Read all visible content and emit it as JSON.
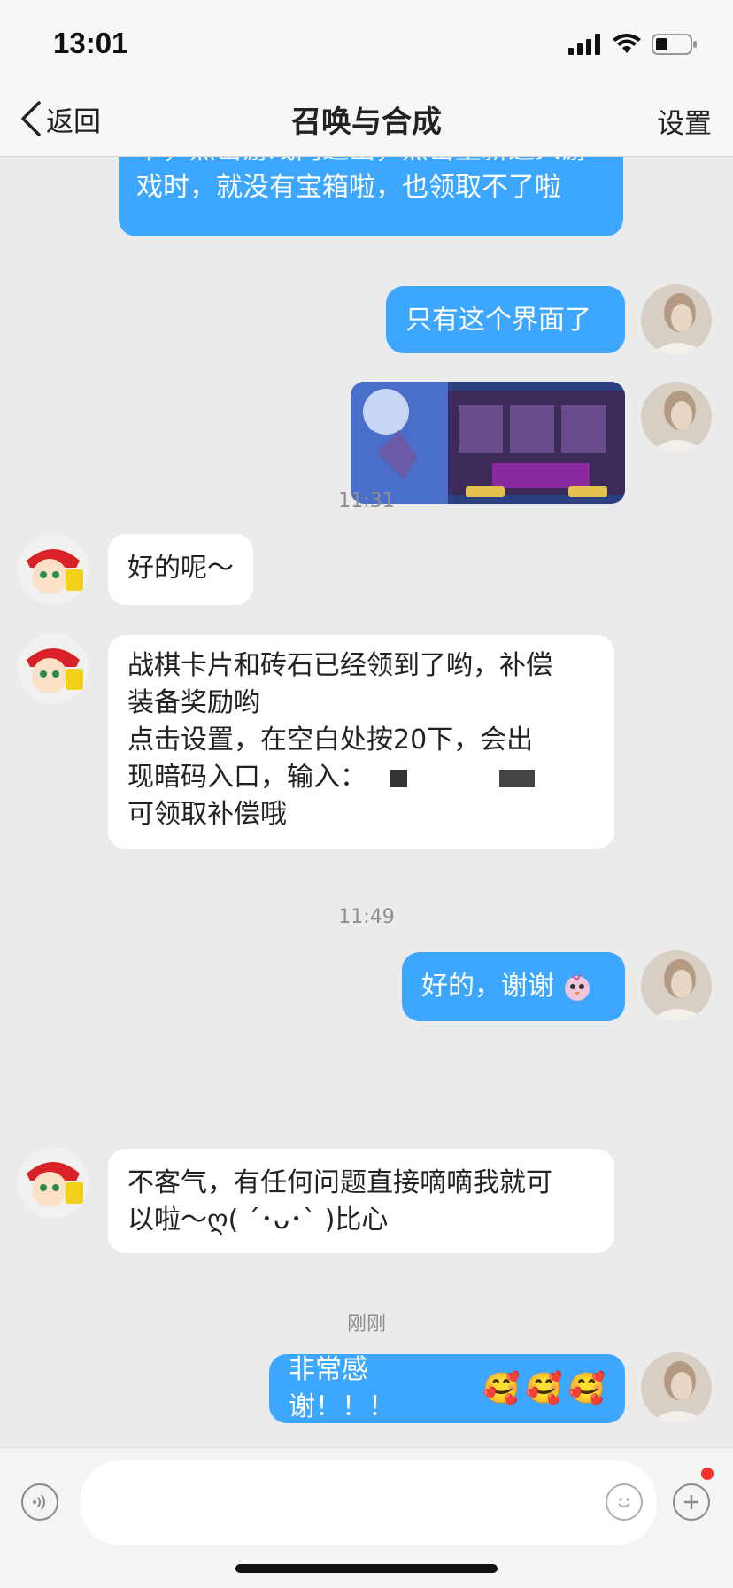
{
  "status_bar": {
    "time": "13:01",
    "battery_level": 0.35
  },
  "nav": {
    "back_label": "返回",
    "title": "召唤与合成",
    "settings_label": "设置"
  },
  "messages": [
    {
      "from": "me",
      "text": "卡，点击游戏内退出，点击重新进入游戏时，就没有宝箱啦，也领取不了啦"
    },
    {
      "from": "me",
      "text": "只有这个界面了"
    },
    {
      "from": "me",
      "type": "image",
      "image_description": "game screenshot"
    },
    {
      "type": "time",
      "text": "11:31"
    },
    {
      "from": "them",
      "text": "好的呢～"
    },
    {
      "from": "them",
      "lines": [
        "战棋卡片和砖石已经领到了哟，补偿",
        "装备奖励哟",
        "点击设置，在空白处按20下，会出",
        "现暗码入口，输入：",
        "可领取补偿哦"
      ]
    },
    {
      "type": "time",
      "text": "11:49"
    },
    {
      "from": "me",
      "text": "好的，谢谢"
    },
    {
      "from": "them",
      "lines": [
        "不客气，有任何问题直接嘀嘀我就可",
        "以啦～ღ( ´･ᴗ･` )比心"
      ]
    },
    {
      "type": "time",
      "text": "刚刚"
    },
    {
      "from": "me",
      "text": "非常感谢！！！"
    }
  ],
  "input": {
    "placeholder": ""
  },
  "icons": {
    "voice": "voice-icon",
    "emoji": "emoji-icon",
    "plus": "plus-icon"
  },
  "colors": {
    "my_bubble": "#3da6ff",
    "their_bubble": "#ffffff",
    "background": "#ebebeb",
    "badge": "#f5322b"
  }
}
